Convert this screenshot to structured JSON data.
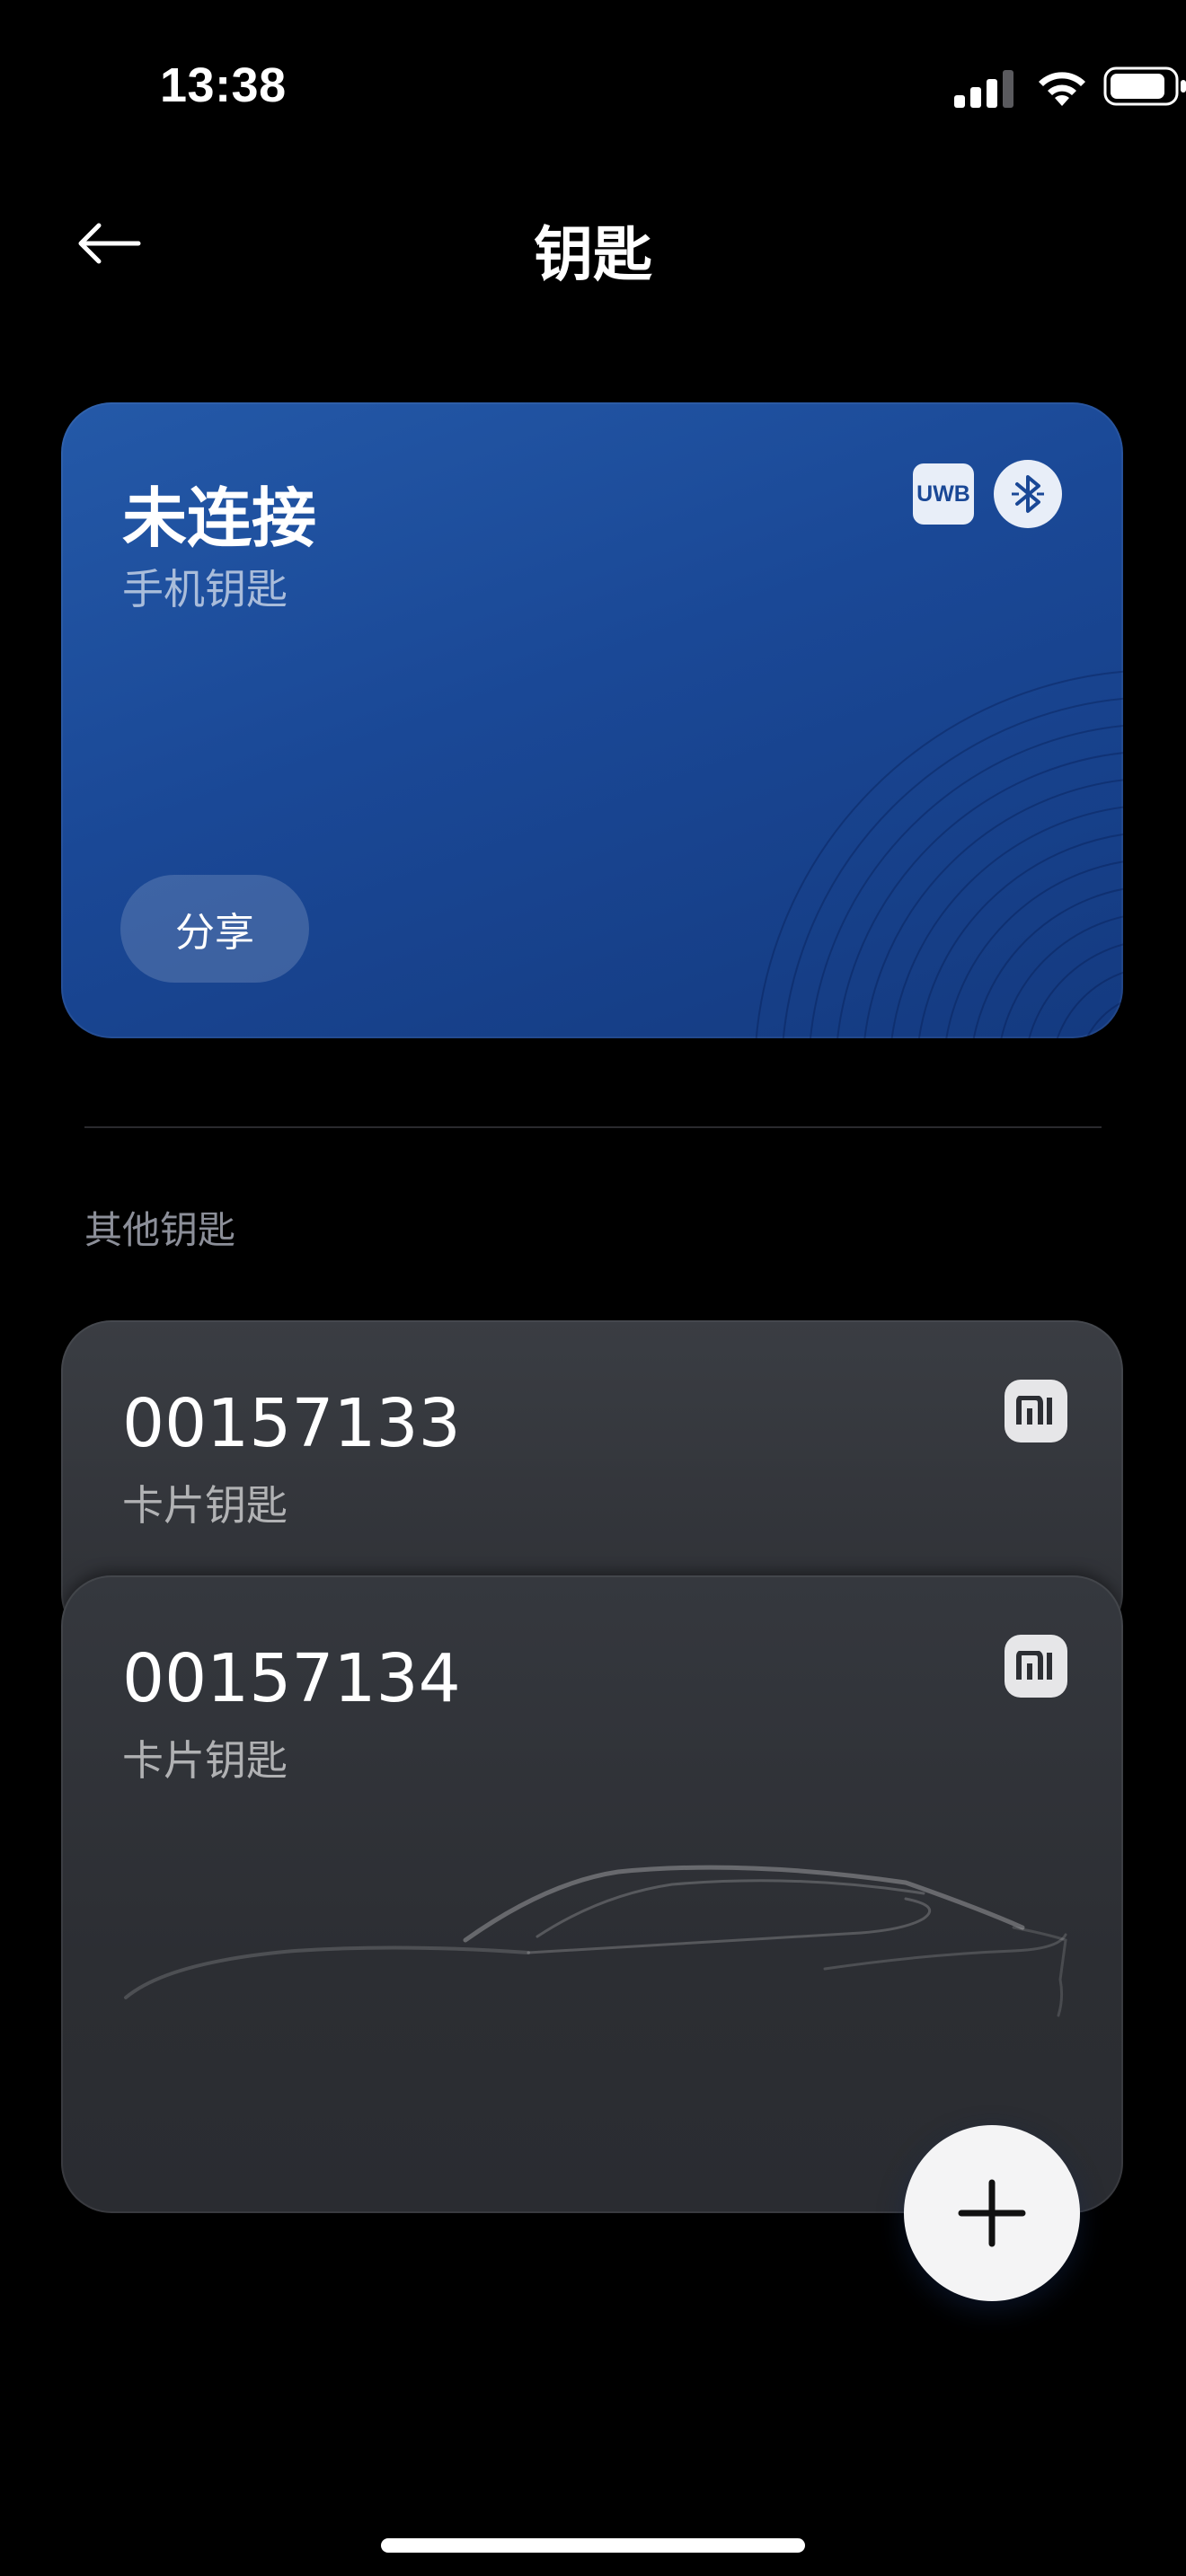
{
  "status_bar": {
    "time": "13:38",
    "icons": [
      "signal-icon",
      "wifi-icon",
      "battery-icon"
    ]
  },
  "header": {
    "title": "钥匙",
    "back_icon": "arrow-left-icon"
  },
  "phone_key": {
    "status": "未连接",
    "subtitle": "手机钥匙",
    "uwb_label": "UWB",
    "bluetooth_icon": "bluetooth-icon",
    "share_label": "分享",
    "accent": "#1a4896"
  },
  "other_keys": {
    "section_label": "其他钥匙",
    "items": [
      {
        "number": "00157133",
        "type": "卡片钥匙",
        "brand_icon": "mi-logo-icon"
      },
      {
        "number": "00157134",
        "type": "卡片钥匙",
        "brand_icon": "mi-logo-icon"
      }
    ]
  },
  "fab": {
    "icon": "plus-icon"
  }
}
